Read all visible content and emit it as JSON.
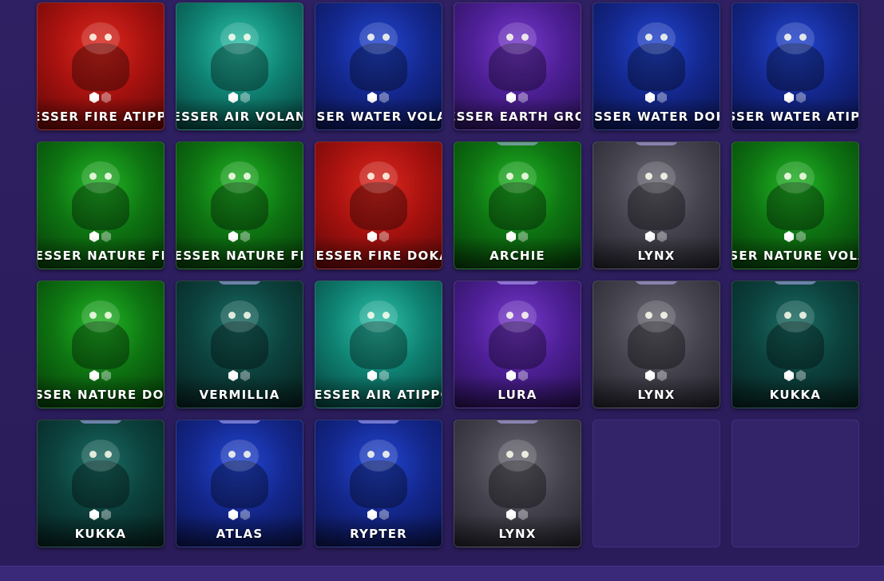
{
  "inventory": {
    "cards": [
      {
        "name": "LESSER FIRE ATIPPO",
        "element": "fire"
      },
      {
        "name": "LESSER AIR VOLANT",
        "element": "air"
      },
      {
        "name": "LESSER WATER VOLANT",
        "element": "water"
      },
      {
        "name": "LESSER EARTH GROK",
        "element": "earth"
      },
      {
        "name": "LESSER WATER DOKA",
        "element": "water"
      },
      {
        "name": "LESSER WATER ATIPPO",
        "element": "water"
      },
      {
        "name": "LESSER NATURE FLI",
        "element": "nature"
      },
      {
        "name": "LESSER NATURE FLI",
        "element": "nature"
      },
      {
        "name": "LESSER FIRE DOKA",
        "element": "fire"
      },
      {
        "name": "ARCHIE",
        "element": "nature"
      },
      {
        "name": "LYNX",
        "element": "gray"
      },
      {
        "name": "LESSER NATURE VOLANT",
        "element": "nature"
      },
      {
        "name": "LESSER NATURE DOKA",
        "element": "nature"
      },
      {
        "name": "VERMILLIA",
        "element": "teal"
      },
      {
        "name": "LESSER AIR ATIPPO",
        "element": "air"
      },
      {
        "name": "LURA",
        "element": "earth"
      },
      {
        "name": "LYNX",
        "element": "gray"
      },
      {
        "name": "KUKKA",
        "element": "teal"
      },
      {
        "name": "KUKKA",
        "element": "teal"
      },
      {
        "name": "ATLAS",
        "element": "water"
      },
      {
        "name": "RYPTER",
        "element": "water"
      },
      {
        "name": "LYNX",
        "element": "gray"
      }
    ],
    "empty_slots": 2
  },
  "colors": {
    "background": "#2b1c5c",
    "empty_slot": "#33246a",
    "fire": "#a8120f",
    "air": "#0f8273",
    "water": "#14288f",
    "earth": "#4d1f95",
    "nature": "#0e7512",
    "gray": "#45434e",
    "teal": "#0c423e",
    "label_text": "#ffffff"
  },
  "icons": {
    "rank": "hexagon-rank-icon"
  }
}
